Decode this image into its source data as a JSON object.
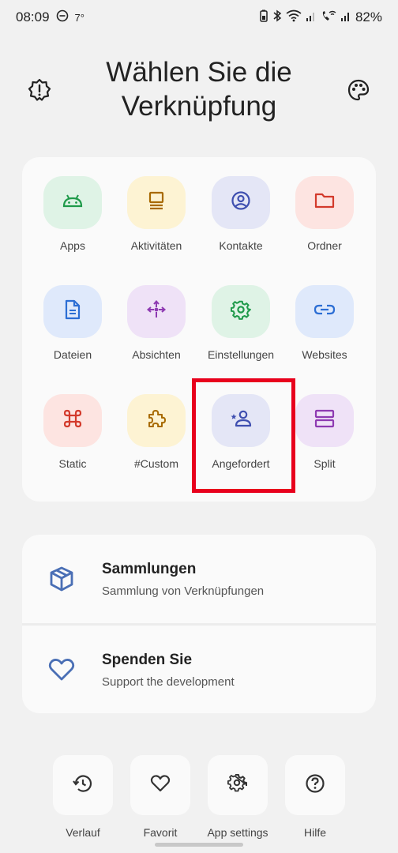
{
  "status_bar": {
    "time": "08:09",
    "temp": "7°",
    "battery": "82%"
  },
  "header": {
    "title_line1": "Wählen Sie die",
    "title_line2": "Verknüpfung"
  },
  "grid": [
    {
      "label": "Apps",
      "icon": "android-icon",
      "bg": "#dff3e6",
      "color": "#1f9a4a"
    },
    {
      "label": "Aktivitäten",
      "icon": "activity-icon",
      "bg": "#fdf3d3",
      "color": "#a86a00"
    },
    {
      "label": "Kontakte",
      "icon": "contact-icon",
      "bg": "#e4e6f6",
      "color": "#3f4fb0"
    },
    {
      "label": "Ordner",
      "icon": "folder-icon",
      "bg": "#fde4e1",
      "color": "#d33a2c"
    },
    {
      "label": "Dateien",
      "icon": "file-icon",
      "bg": "#dfe9fb",
      "color": "#2c6ed4"
    },
    {
      "label": "Absichten",
      "icon": "intent-icon",
      "bg": "#efe2f7",
      "color": "#8e3ab2"
    },
    {
      "label": "Einstellungen",
      "icon": "settings-icon",
      "bg": "#dff3e6",
      "color": "#1f9a4a"
    },
    {
      "label": "Websites",
      "icon": "link-icon",
      "bg": "#dfe9fb",
      "color": "#2c6ed4"
    },
    {
      "label": "Static",
      "icon": "command-icon",
      "bg": "#fde4e1",
      "color": "#d33a2c"
    },
    {
      "label": "#Custom",
      "icon": "puzzle-icon",
      "bg": "#fdf3d3",
      "color": "#a86a00"
    },
    {
      "label": "Angefordert",
      "icon": "person-star-icon",
      "bg": "#e4e6f6",
      "color": "#3f4fb0"
    },
    {
      "label": "Split",
      "icon": "split-icon",
      "bg": "#efe2f7",
      "color": "#8e3ab2"
    }
  ],
  "list": [
    {
      "title": "Sammlungen",
      "subtitle": "Sammlung von Verknüpfungen",
      "icon": "box-icon"
    },
    {
      "title": "Spenden Sie",
      "subtitle": "Support the development",
      "icon": "heart-icon"
    }
  ],
  "bottom": [
    {
      "label": "Verlauf",
      "icon": "history-icon"
    },
    {
      "label": "Favorit",
      "icon": "heart-icon"
    },
    {
      "label": "App settings",
      "icon": "app-settings-icon"
    },
    {
      "label": "Hilfe",
      "icon": "help-icon"
    }
  ],
  "colors": {
    "accent_icon": "#4a6fb5",
    "highlight": "#e8001c"
  }
}
